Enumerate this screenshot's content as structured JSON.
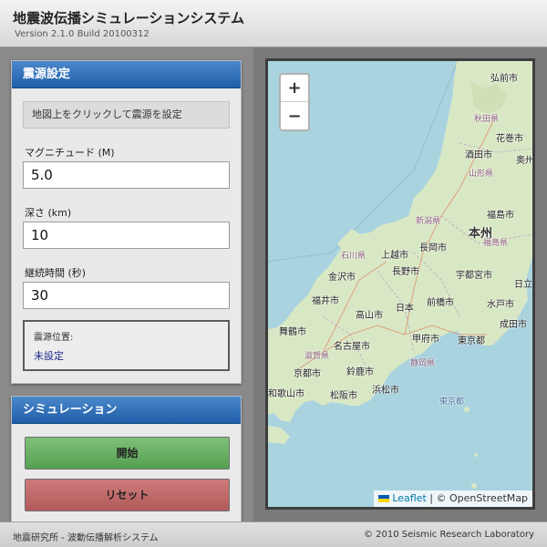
{
  "header": {
    "title": "地震波伝播シミュレーションシステム",
    "version": "Version 2.1.0 Build 20100312"
  },
  "source_panel": {
    "title": "震源設定",
    "hint": "地図上をクリックして震源を設定",
    "magnitude_label": "マグニチュード (M)",
    "magnitude_value": "5.0",
    "depth_label": "深さ (km)",
    "depth_value": "10",
    "duration_label": "継続時間 (秒)",
    "duration_value": "30",
    "location_label": "震源位置:",
    "location_value": "未設定"
  },
  "sim_panel": {
    "title": "シミュレーション",
    "start_label": "開始",
    "reset_label": "リセット"
  },
  "map": {
    "zoom_in": "+",
    "zoom_out": "−",
    "attribution_leaflet": "Leaflet",
    "attribution_sep": "|",
    "attribution_osm": "© OpenStreetMap",
    "labels": {
      "hirosaki": "弘前市",
      "akita": "秋田県",
      "hanamaki": "花巻市",
      "sakata": "酒田市",
      "oshu": "奥州",
      "yamagata": "山形県",
      "niigata": "新潟県",
      "fukushima_city": "福島市",
      "honshu": "本州",
      "fukushima_pref": "福島県",
      "ishikawa": "石川県",
      "joetsu": "上越市",
      "nagaoka": "長岡市",
      "kanazawa": "金沢市",
      "nagano": "長野市",
      "utsunomiya": "宇都宮市",
      "hitachi": "日立",
      "fukui": "福井市",
      "nihon": "日本",
      "maebashi": "前橋市",
      "mito": "水戸市",
      "takayama": "高山市",
      "narita": "成田市",
      "maizuru": "舞鶴市",
      "nagoya": "名古屋市",
      "kofu": "甲府市",
      "tokyo": "東京都",
      "shiga": "滋賀県",
      "kyoto": "京都市",
      "suzuka": "鈴鹿市",
      "shizuoka": "静岡県",
      "wakayama": "和歌山市",
      "matsusaka": "松阪市",
      "hamamatsu": "浜松市",
      "tokyo_bay": "東京都"
    }
  },
  "footer": {
    "left": "地震研究所 - 波動伝播解析システム",
    "right": "© 2010 Seismic Research Laboratory"
  },
  "colors": {
    "panel_header": "#2a6cb6",
    "start_button": "#6bb066",
    "reset_button": "#c26a6a",
    "sea": "#a9d3df",
    "land": "#d9e8c4"
  }
}
